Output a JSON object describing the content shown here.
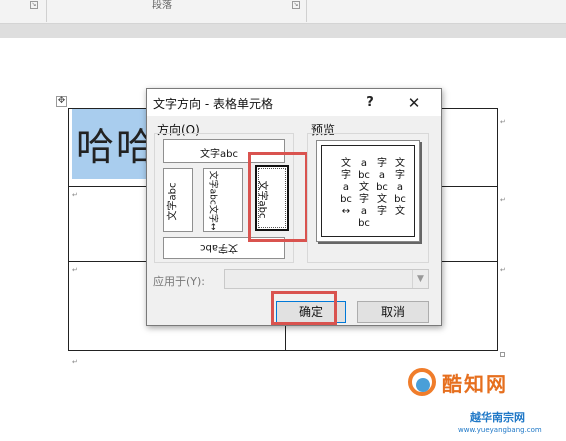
{
  "ribbon": {
    "group_paragraph": "段落"
  },
  "document": {
    "cell_text": "哈哈",
    "cell_marks": [
      "↵",
      "↵",
      "↵",
      "↵",
      "↵",
      "↵",
      "↵"
    ]
  },
  "dialog": {
    "title": "文字方向 - 表格单元格",
    "help_label": "?",
    "close_label": "✕",
    "orientation_group": "方向(O)",
    "preview_group": "预览",
    "orientations": {
      "horizontal": "文字abc",
      "vertical_rot_left": "文字abc",
      "stacked": "文字abc文字↔",
      "vertical_rot_right": "文字abc",
      "horizontal_upside": "文字abc"
    },
    "preview_columns": [
      "文字abc文",
      "字abc文字",
      "abc文字abc",
      "文字abc↔"
    ],
    "apply_to_label": "应用于(Y):",
    "apply_to_value": "",
    "ok_label": "确定",
    "cancel_label": "取消"
  },
  "watermark": {
    "brand": "酷知网",
    "sub": "越华南宗网",
    "url": "www.yueyangbang.com"
  },
  "colors": {
    "highlight": "#a9cdee",
    "callout": "#d9534f",
    "focus": "#0078d7"
  }
}
